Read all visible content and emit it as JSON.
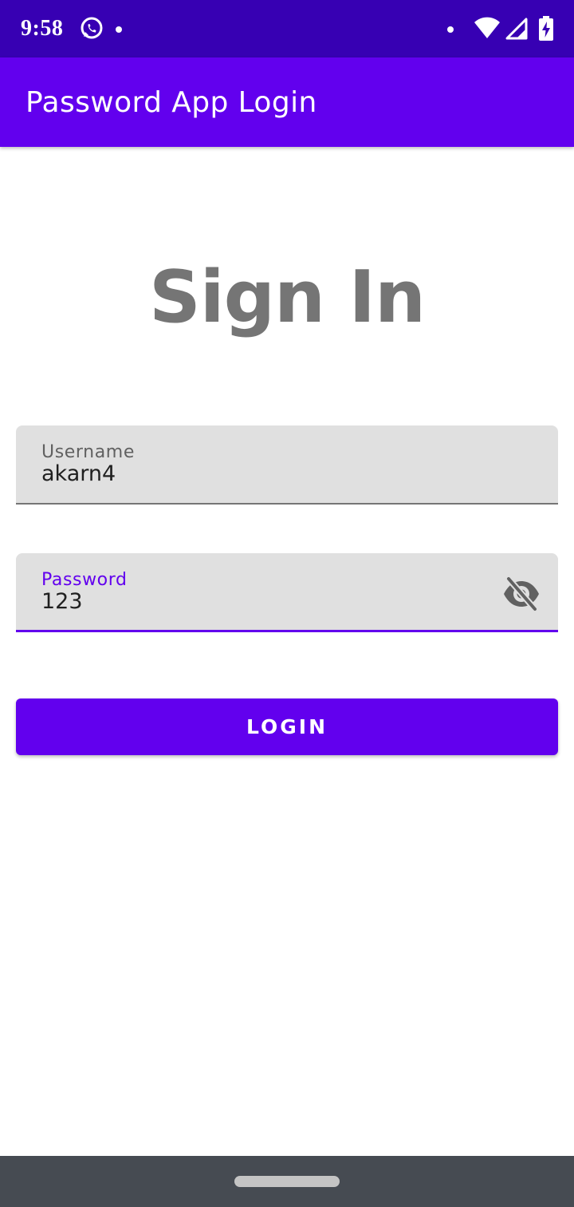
{
  "status_bar": {
    "time": "9:58",
    "icons": [
      "whatsapp-icon",
      "notification-dot-icon",
      "dot-icon",
      "wifi-icon",
      "cellular-signal-icon",
      "battery-charging-icon"
    ]
  },
  "app_bar": {
    "title": "Password App Login"
  },
  "main": {
    "heading": "Sign In",
    "username": {
      "label": "Username",
      "value": "akarn4"
    },
    "password": {
      "label": "Password",
      "value": "123",
      "toggle_icon": "visibility-off-icon"
    },
    "login_label": "LOGIN"
  },
  "colors": {
    "status_bar": "#3700b3",
    "primary": "#6200ee",
    "heading_text": "#757575",
    "field_background": "#e0e0e0",
    "nav_bar": "#464b52"
  }
}
